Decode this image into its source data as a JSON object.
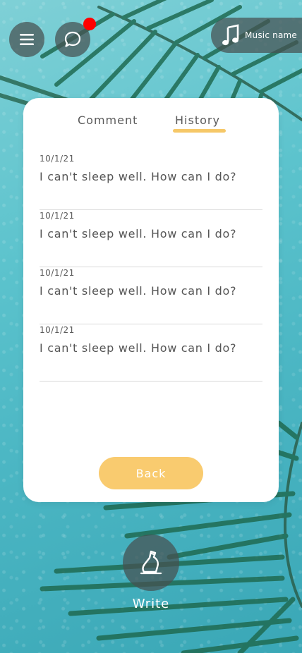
{
  "header": {
    "music_label": "Music name",
    "notification_color": "#ff0000"
  },
  "tabs": [
    {
      "label": "Comment",
      "active": false
    },
    {
      "label": "History",
      "active": true
    }
  ],
  "history": [
    {
      "date": "10/1/21",
      "text": "I can't sleep well. How can I do?"
    },
    {
      "date": "10/1/21",
      "text": "I can't sleep well. How can I do?"
    },
    {
      "date": "10/1/21",
      "text": "I can't sleep well. How can I do?"
    },
    {
      "date": "10/1/21",
      "text": "I can't sleep well. How can I do?"
    }
  ],
  "buttons": {
    "back_label": "Back",
    "write_label": "Write"
  },
  "colors": {
    "accent": "#f9cb6f",
    "underline": "#f6c868"
  }
}
